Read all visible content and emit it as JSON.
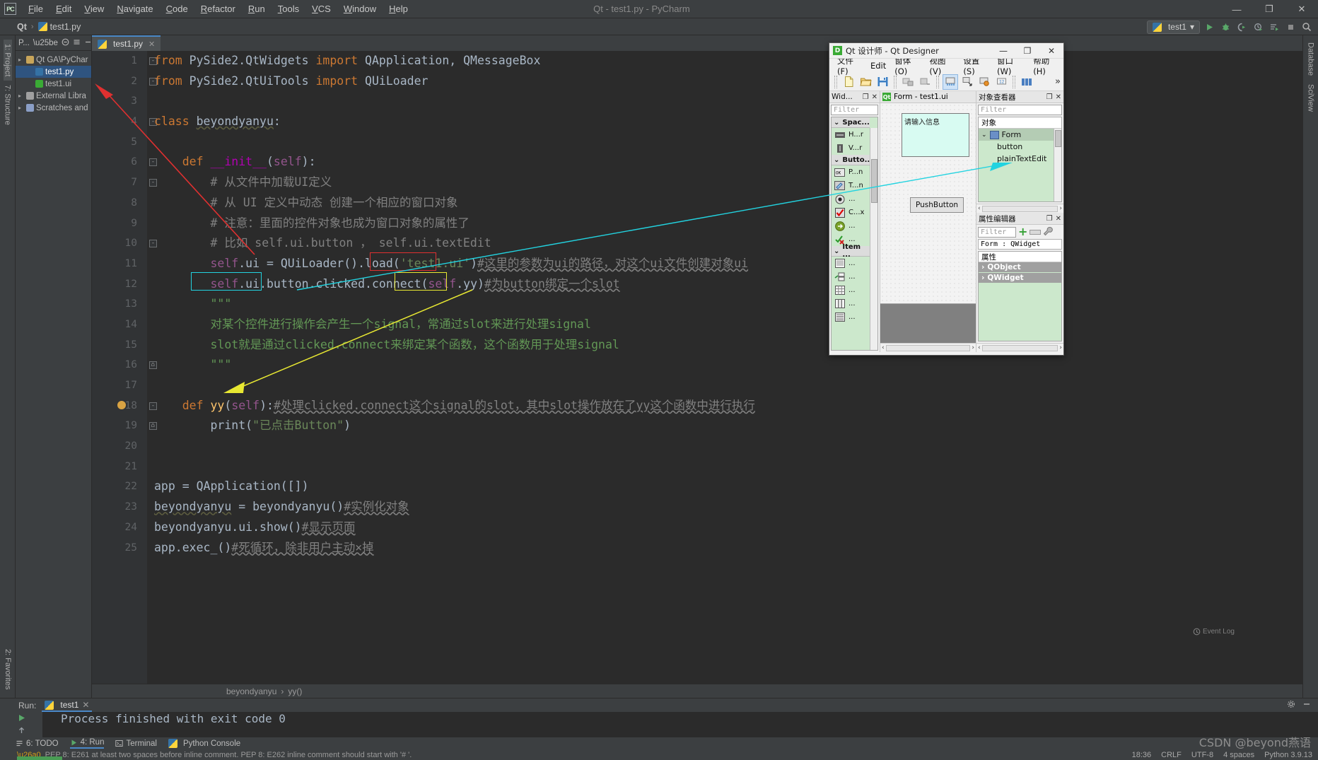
{
  "app": {
    "title": "Qt - test1.py - PyCharm",
    "logo": "pycharm-logo"
  },
  "menubar": [
    "File",
    "Edit",
    "View",
    "Navigate",
    "Code",
    "Refactor",
    "Run",
    "Tools",
    "VCS",
    "Window",
    "Help"
  ],
  "window_controls": {
    "minimize": "—",
    "restore": "❐",
    "close": "✕"
  },
  "navbar": {
    "crumb_project": "Qt",
    "crumb_sep": "›",
    "crumb_file": "test1.py",
    "run_config": "test1",
    "dropdown_caret": "▾",
    "icons": [
      "run-icon",
      "debug-icon",
      "coverage-icon",
      "profile-icon",
      "run-with-icon",
      "stop-icon",
      "search-icon"
    ]
  },
  "left_strip": {
    "project": "1: Project",
    "structure": "7: Structure",
    "favorites": "2: Favorites"
  },
  "right_strip": {
    "database": "Database",
    "sciview": "SciView"
  },
  "project_panel": {
    "header": "P...",
    "items": [
      {
        "label": "Qt  GA\\PyChar",
        "indent": 0,
        "color": "#c8a55a",
        "selected": false
      },
      {
        "label": "test1.py",
        "indent": 1,
        "color": "#3572A5",
        "selected": true
      },
      {
        "label": "test1.ui",
        "indent": 1,
        "color": "#3aaa35",
        "selected": false
      },
      {
        "label": "External Libra",
        "indent": 0,
        "color": "#a0a0a0",
        "selected": false
      },
      {
        "label": "Scratches and",
        "indent": 0,
        "color": "#8b9fc7",
        "selected": false
      }
    ]
  },
  "editor": {
    "tab": "test1.py",
    "tab_close": "✕",
    "first_line": 1,
    "lines": [
      {
        "n": 1,
        "fold": "-",
        "html": "<span class=\"kw\">from</span> PySide2.QtWidgets <span class=\"kw\">import</span> QApplication, QMessageBox"
      },
      {
        "n": 2,
        "fold": "-",
        "html": "<span class=\"kw\">from</span> PySide2.QtUiTools <span class=\"kw\">import</span> QUiLoader"
      },
      {
        "n": 3,
        "fold": "",
        "html": ""
      },
      {
        "n": 4,
        "fold": "-",
        "html": "<span class=\"kw\">class</span> <span class=\"cls\">beyondyanyu</span>:"
      },
      {
        "n": 5,
        "fold": "",
        "html": ""
      },
      {
        "n": 6,
        "fold": "-",
        "html": "    <span class=\"kw\">def</span> <span class=\"dun\">__init__</span>(<span class=\"sf\">self</span>):"
      },
      {
        "n": 7,
        "fold": "-",
        "html": "        <span class=\"cmt\"># 从文件中加载UI定义</span>"
      },
      {
        "n": 8,
        "fold": "",
        "html": "        <span class=\"cmt\"># 从 UI 定义中动态 创建一个相应的窗口对象</span>"
      },
      {
        "n": 9,
        "fold": "",
        "html": "        <span class=\"cmt\"># 注意：里面的控件对象也成为窗口对象的属性了</span>"
      },
      {
        "n": 10,
        "fold": "-",
        "html": "        <span class=\"cmt\"># 比如 self.ui.button ， self.ui.textEdit</span>"
      },
      {
        "n": 11,
        "fold": "",
        "html": "        <span class=\"sf\">self</span>.ui = QUiLoader().load(<span class=\"str\">'test1.ui'</span>)<span class=\"cmt warnu\">#这里的参数为ui的路径，对这个ui文件创建对象ui</span>"
      },
      {
        "n": 12,
        "fold": "",
        "html": "        <span class=\"sf\">self</span>.ui.button.clicked.connect(<span class=\"sf\">self</span>.yy)<span class=\"cmt warnu\">#为button绑定一个slot</span>"
      },
      {
        "n": 13,
        "fold": "",
        "html": "        <span class=\"doc\">\"\"\"</span>"
      },
      {
        "n": 14,
        "fold": "",
        "html": "        <span class=\"doc\">对某个控件进行操作会产生一个signal，常通过slot来进行处理signal</span>"
      },
      {
        "n": 15,
        "fold": "",
        "html": "        <span class=\"doc\">slot就是通过clicked.connect来绑定某个函数，这个函数用于处理signal</span>"
      },
      {
        "n": 16,
        "fold": "⌂",
        "html": "        <span class=\"doc\">\"\"\"</span>"
      },
      {
        "n": 17,
        "fold": "",
        "html": ""
      },
      {
        "n": 18,
        "fold": "-",
        "html": "    <span class=\"kw\">def</span> <span class=\"fn\">yy</span>(<span class=\"sf\">self</span>):<span class=\"cmt warnu\">#处理clicked.connect这个signal的slot，其中slot操作放在了yy这个函数中进行执行</span>"
      },
      {
        "n": 19,
        "fold": "⌂",
        "html": "        print(<span class=\"str\">\"已点击Button\"</span>)"
      },
      {
        "n": 20,
        "fold": "",
        "html": ""
      },
      {
        "n": 21,
        "fold": "",
        "html": ""
      },
      {
        "n": 22,
        "fold": "",
        "html": "app = QApplication([])"
      },
      {
        "n": 23,
        "fold": "",
        "html": "<span class=\"cls\">beyondyanyu</span> = beyondyanyu()<span class=\"cmt warnu\">#实例化对象</span>"
      },
      {
        "n": 24,
        "fold": "",
        "html": "beyondyanyu.ui.show()<span class=\"cmt warnu\">#显示页面</span>"
      },
      {
        "n": 25,
        "fold": "",
        "html": "app.exec_()<span class=\"cmt warnu\">#死循环，除非用户主动×掉</span>"
      }
    ],
    "breadcrumbs": [
      "beyondyanyu",
      "yy()"
    ],
    "breadcrumb_sep": "›"
  },
  "annotations": {
    "boxes": [
      {
        "name": "ui-path-box",
        "color": "#e03030"
      },
      {
        "name": "ui-button-box",
        "color": "#22d3e0"
      },
      {
        "name": "self-yy-box",
        "color": "#e8e832"
      }
    ],
    "arrows": [
      {
        "name": "red-arrow",
        "color": "#e03030"
      },
      {
        "name": "cyan-arrow",
        "color": "#22d3e0"
      },
      {
        "name": "yellow-arrow",
        "color": "#e8e832"
      }
    ]
  },
  "run_panel": {
    "label": "Run:",
    "tab": "test1",
    "tab_close": "✕",
    "output": "Process finished with exit code 0",
    "settings_icon": "gear-icon",
    "hide_icon": "minimize-icon"
  },
  "statusbar": {
    "todo": "6: TODO",
    "run": "4: Run",
    "terminal": "Terminal",
    "python_console": "Python Console",
    "inspection": "PEP 8: E261 at least two spaces before inline comment. PEP 8: E262 inline comment should start with '# '.",
    "position": "18:36",
    "line_sep": "CRLF",
    "encoding": "UTF-8",
    "indent": "4 spaces",
    "interpreter": "Python 3.9.13",
    "event_log": "Event Log"
  },
  "watermark": "CSDN @beyond燕语",
  "qt_designer": {
    "title": "Qt 设计师 - Qt Designer",
    "app_icon": "D",
    "window_controls": {
      "minimize": "—",
      "restore": "❐",
      "close": "✕"
    },
    "menu": [
      "文件(F)",
      "Edit",
      "窗体(O)",
      "视图(V)",
      "设置(S)",
      "窗口(W)",
      "帮助(H)"
    ],
    "toolbar_icons": [
      "new-form-icon",
      "open-icon",
      "save-icon",
      "edit-widgets-icon",
      "edit-signals-icon",
      "edit-buddies-icon",
      "edit-tab-order-icon",
      "layout-horizontal-icon",
      "overflow-icon"
    ],
    "toolbar_overflow": "»",
    "widget_box": {
      "title": "Wid...",
      "float_icon": "❐",
      "close_icon": "✕",
      "filter_placeholder": "Filter",
      "groups": [
        {
          "name": "Spac...",
          "items": [
            {
              "icon": "h-spacer-icon",
              "label": "H...r"
            },
            {
              "icon": "v-spacer-icon",
              "label": "V...r"
            }
          ]
        },
        {
          "name": "Butto...",
          "items": [
            {
              "icon": "push-button-icon",
              "label": "P...n"
            },
            {
              "icon": "tool-button-icon",
              "label": "T...n"
            },
            {
              "icon": "radio-button-icon",
              "label": "..."
            },
            {
              "icon": "check-box-icon",
              "label": "C...x"
            },
            {
              "icon": "command-link-icon",
              "label": "..."
            },
            {
              "icon": "dialog-buttonbox-icon",
              "label": "..."
            }
          ]
        },
        {
          "name": "Item ...",
          "items": [
            {
              "icon": "list-view-icon",
              "label": "..."
            },
            {
              "icon": "tree-view-icon",
              "label": "..."
            },
            {
              "icon": "table-view-icon",
              "label": "..."
            },
            {
              "icon": "column-view-icon",
              "label": "..."
            },
            {
              "icon": "list-widget-icon",
              "label": "..."
            }
          ]
        }
      ]
    },
    "form_window": {
      "title": "Form - test1.ui",
      "plain_text_edit_text": "请输入信息",
      "push_button_label": "PushButton",
      "scroll_left": "‹",
      "scroll_right": "›"
    },
    "object_inspector": {
      "title": "对象查看器",
      "float_icon": "❐",
      "close_icon": "✕",
      "filter_placeholder": "Filter",
      "column_header": "对象",
      "tree": [
        {
          "label": "Form",
          "indent": 0,
          "selected": true,
          "expander": "⌄"
        },
        {
          "label": "button",
          "indent": 1,
          "selected": false,
          "expander": ""
        },
        {
          "label": "plainTextEdit",
          "indent": 1,
          "selected": false,
          "expander": ""
        }
      ],
      "scroll_left": "‹",
      "scroll_right": "›"
    },
    "property_editor": {
      "title": "属性编辑器",
      "float_icon": "❐",
      "close_icon": "✕",
      "filter_placeholder": "Filter",
      "add_icon": "plus-icon",
      "remove_icon": "minus-icon",
      "configure_icon": "wrench-icon",
      "object_line": "Form : QWidget",
      "column_header": "属性",
      "groups": [
        {
          "label": "QObject",
          "expander": "›"
        },
        {
          "label": "QWidget",
          "expander": "›"
        }
      ],
      "scroll_left": "‹",
      "scroll_right": "›"
    }
  }
}
